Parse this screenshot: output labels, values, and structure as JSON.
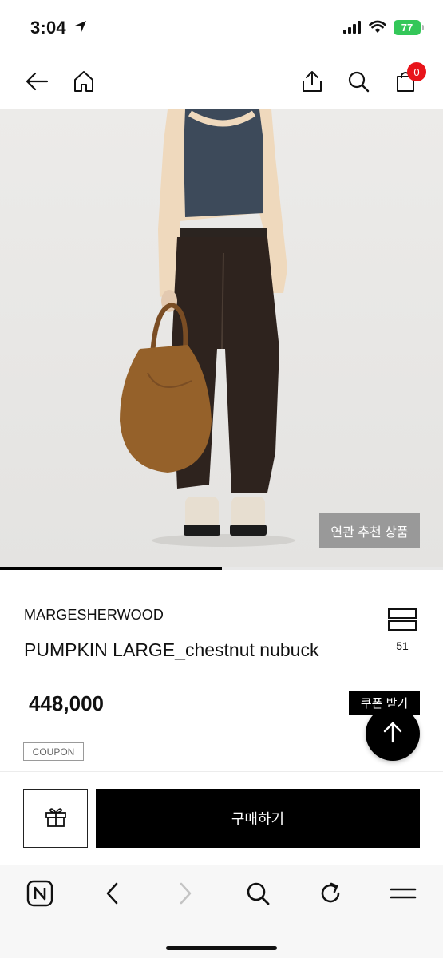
{
  "status_bar": {
    "time": "3:04",
    "battery": "77"
  },
  "nav": {
    "cart_count": "0"
  },
  "image": {
    "related_button": "연관 추천 상품",
    "progress": 0.5
  },
  "product": {
    "brand": "MARGESHERWOOD",
    "name": "PUMPKIN LARGE_chestnut nubuck",
    "wish_count": "51",
    "price": "448,000",
    "coupon_button": "쿠폰 받기",
    "coupon_tag": "COUPON"
  },
  "purchase": {
    "buy_label": "구매하기"
  },
  "icons": {
    "nav": [
      "back-arrow-icon",
      "home-icon",
      "share-icon",
      "search-icon",
      "shopping-bag-icon"
    ],
    "browser": [
      "naver-icon",
      "browser-back-icon",
      "browser-forward-icon",
      "browser-search-icon",
      "refresh-icon",
      "menu-icon"
    ]
  },
  "colors": {
    "battery": "#34c759",
    "badge": "#e8141a",
    "primary": "#000000"
  }
}
